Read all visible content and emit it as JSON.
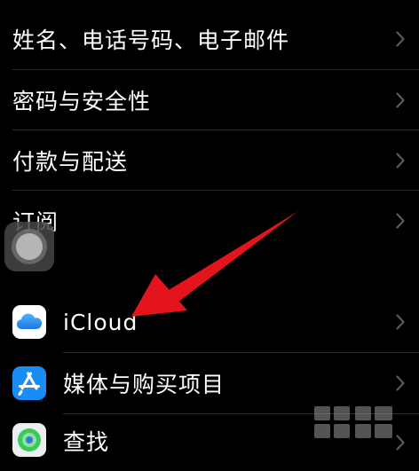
{
  "settings_list": {
    "rows": [
      {
        "label": "姓名、电话号码、电子邮件"
      },
      {
        "label": "密码与安全性"
      },
      {
        "label": "付款与配送"
      },
      {
        "label": "订阅"
      },
      {
        "label": "iCloud",
        "icon": "icloud-icon"
      },
      {
        "label": "媒体与购买项目",
        "icon": "app-store-icon"
      },
      {
        "label": "查找",
        "icon": "find-my-icon"
      }
    ]
  },
  "colors": {
    "background": "#000000",
    "separator": "#2c2c2e",
    "chevron": "#5a5a5e",
    "annotation_arrow": "#e3141c",
    "app_store_blue": "#1a8cf6"
  }
}
